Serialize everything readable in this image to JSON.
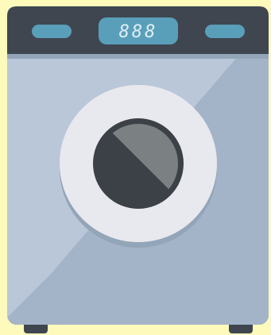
{
  "appliance": {
    "name": "washing-machine",
    "display": {
      "digits": "888"
    }
  },
  "colors": {
    "background": "#fdfabb",
    "control_panel": "#3f4650",
    "body_light": "#b9c7d9",
    "body_dark": "#a4b4c8",
    "accent_blue": "#5a9fba",
    "door_ring": "#e8e9ee",
    "door_shadow": "#93a5b8",
    "drum": "#3b4146",
    "drum_glass": "#7b8083",
    "feet": "#3f4650",
    "display_text": "#dfeef5"
  }
}
